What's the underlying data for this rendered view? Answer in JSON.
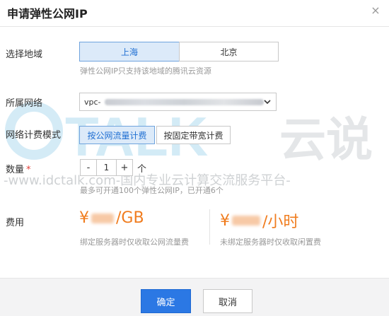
{
  "dialog": {
    "title": "申请弹性公网IP",
    "close_glyph": "×"
  },
  "watermark": {
    "brand": "TALK",
    "brand_cn": "云说",
    "slogan": "-www.idctalk.com-国内专业云计算交流服务平台-"
  },
  "region": {
    "label": "选择地域",
    "options": [
      "上海",
      "北京"
    ],
    "selected": "上海",
    "hint": "弹性公网IP只支持该地域的腾讯云资源"
  },
  "network": {
    "label": "所属网络",
    "value_prefix": "vpc-"
  },
  "billing": {
    "label": "网络计费模式",
    "options": [
      "按公网流量计费",
      "按固定带宽计费"
    ],
    "selected": "按公网流量计费"
  },
  "quantity": {
    "label": "数量",
    "required_mark": "*",
    "minus": "-",
    "value": "1",
    "plus": "+",
    "unit": "个",
    "hint": "最多可开通100个弹性公网IP，已开通6个"
  },
  "fee": {
    "label": "费用",
    "bound": {
      "currency": "¥",
      "unit": "/GB",
      "note": "绑定服务器时仅收取公网流量费"
    },
    "unbound": {
      "currency": "¥",
      "unit": "/小时",
      "note": "未绑定服务器时仅收取闲置费"
    }
  },
  "footer": {
    "confirm": "确定",
    "cancel": "取消"
  },
  "colors": {
    "primary": "#2b78e4",
    "price": "#f07c1e",
    "selected_bg": "#dceaf9",
    "required": "#e3413b"
  }
}
